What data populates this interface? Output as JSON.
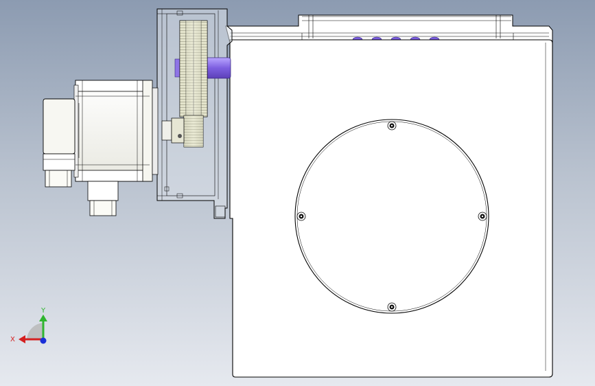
{
  "viewport": {
    "view_name": "",
    "background_top": "#8c9bb1",
    "background_bottom": "#e6e9ef"
  },
  "model": {
    "parts": [
      "servo-motor",
      "motor-connector",
      "encoder-connector",
      "gearbox-housing",
      "large-spur-gear",
      "pinion-gear",
      "drive-shaft",
      "rotary-table-base",
      "turntable-plate",
      "mounting-bolt"
    ],
    "bolt_count_on_plate": 4,
    "colors": {
      "body": "#ffffff",
      "outline": "#000000",
      "gear": "#dcdcc4",
      "shaft": "#8e74e6",
      "motor": "#fafafa"
    }
  },
  "triad": {
    "x_label": "X",
    "y_label": "Y",
    "x_color": "#d42020",
    "y_color": "#2fb52f",
    "z_color": "#1a2fd8"
  }
}
